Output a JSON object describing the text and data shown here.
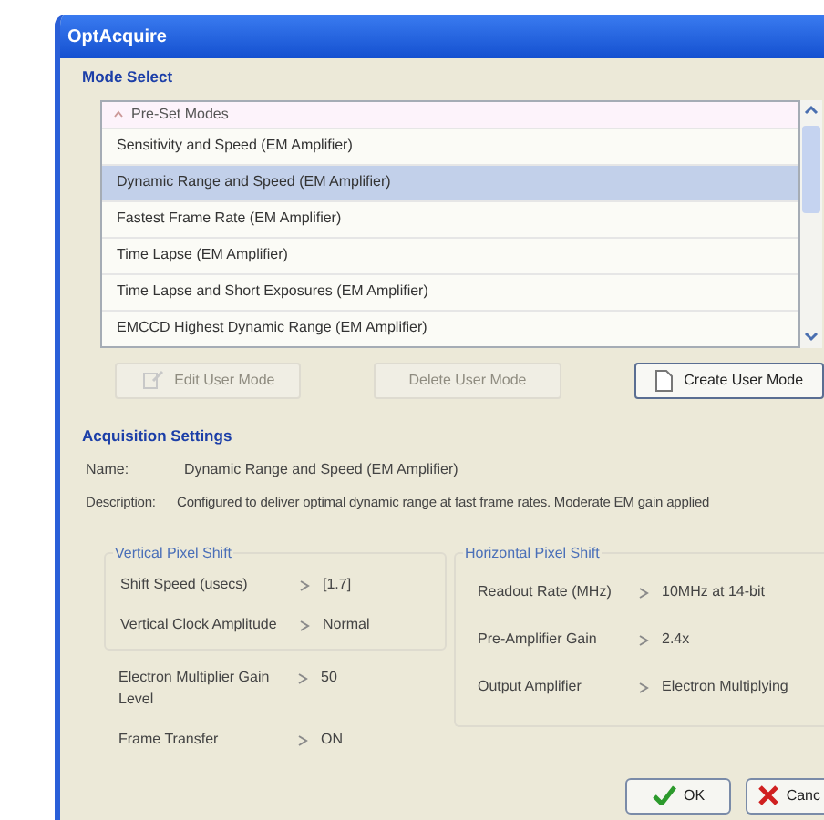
{
  "window": {
    "title": "OptAcquire"
  },
  "mode_select": {
    "heading": "Mode Select",
    "list_header": "Pre-Set Modes",
    "modes": [
      {
        "label": "Sensitivity and Speed (EM Amplifier)",
        "selected": false
      },
      {
        "label": "Dynamic Range and Speed (EM Amplifier)",
        "selected": true
      },
      {
        "label": "Fastest Frame Rate (EM Amplifier)",
        "selected": false
      },
      {
        "label": "Time Lapse (EM Amplifier)",
        "selected": false
      },
      {
        "label": "Time Lapse and Short Exposures (EM Amplifier)",
        "selected": false
      },
      {
        "label": "EMCCD Highest Dynamic Range (EM Amplifier)",
        "selected": false
      }
    ]
  },
  "mode_buttons": [
    {
      "label": "Edit User Mode",
      "kind": "edit",
      "disabled": true
    },
    {
      "label": "Delete User Mode",
      "kind": "delete",
      "disabled": true
    },
    {
      "label": "Create User Mode",
      "kind": "create",
      "disabled": false
    }
  ],
  "acquisition": {
    "heading": "Acquisition Settings",
    "name_label": "Name:",
    "name": "Dynamic Range and Speed (EM Amplifier)",
    "description_label": "Description:",
    "description": "Configured to deliver optimal dynamic range at fast frame rates. Moderate EM gain applied"
  },
  "vertical_pixel_shift": {
    "title": "Vertical Pixel Shift",
    "rows": [
      {
        "label": "Shift Speed (usecs)",
        "value": "[1.7]"
      },
      {
        "label": "Vertical Clock Amplitude",
        "value": "Normal"
      }
    ]
  },
  "other_settings": [
    {
      "label": "Electron Multiplier Gain Level",
      "value": "50"
    },
    {
      "label": "Frame Transfer",
      "value": "ON"
    }
  ],
  "horizontal_pixel_shift": {
    "title": "Horizontal Pixel Shift",
    "rows": [
      {
        "label": "Readout Rate (MHz)",
        "value": "10MHz at 14-bit"
      },
      {
        "label": "Pre-Amplifier Gain",
        "value": "2.4x"
      },
      {
        "label": "Output Amplifier",
        "value": "Electron Multiplying"
      }
    ]
  },
  "dialog_buttons": [
    {
      "label": "OK",
      "kind": "ok"
    },
    {
      "label": "Canc",
      "kind": "cancel"
    }
  ]
}
